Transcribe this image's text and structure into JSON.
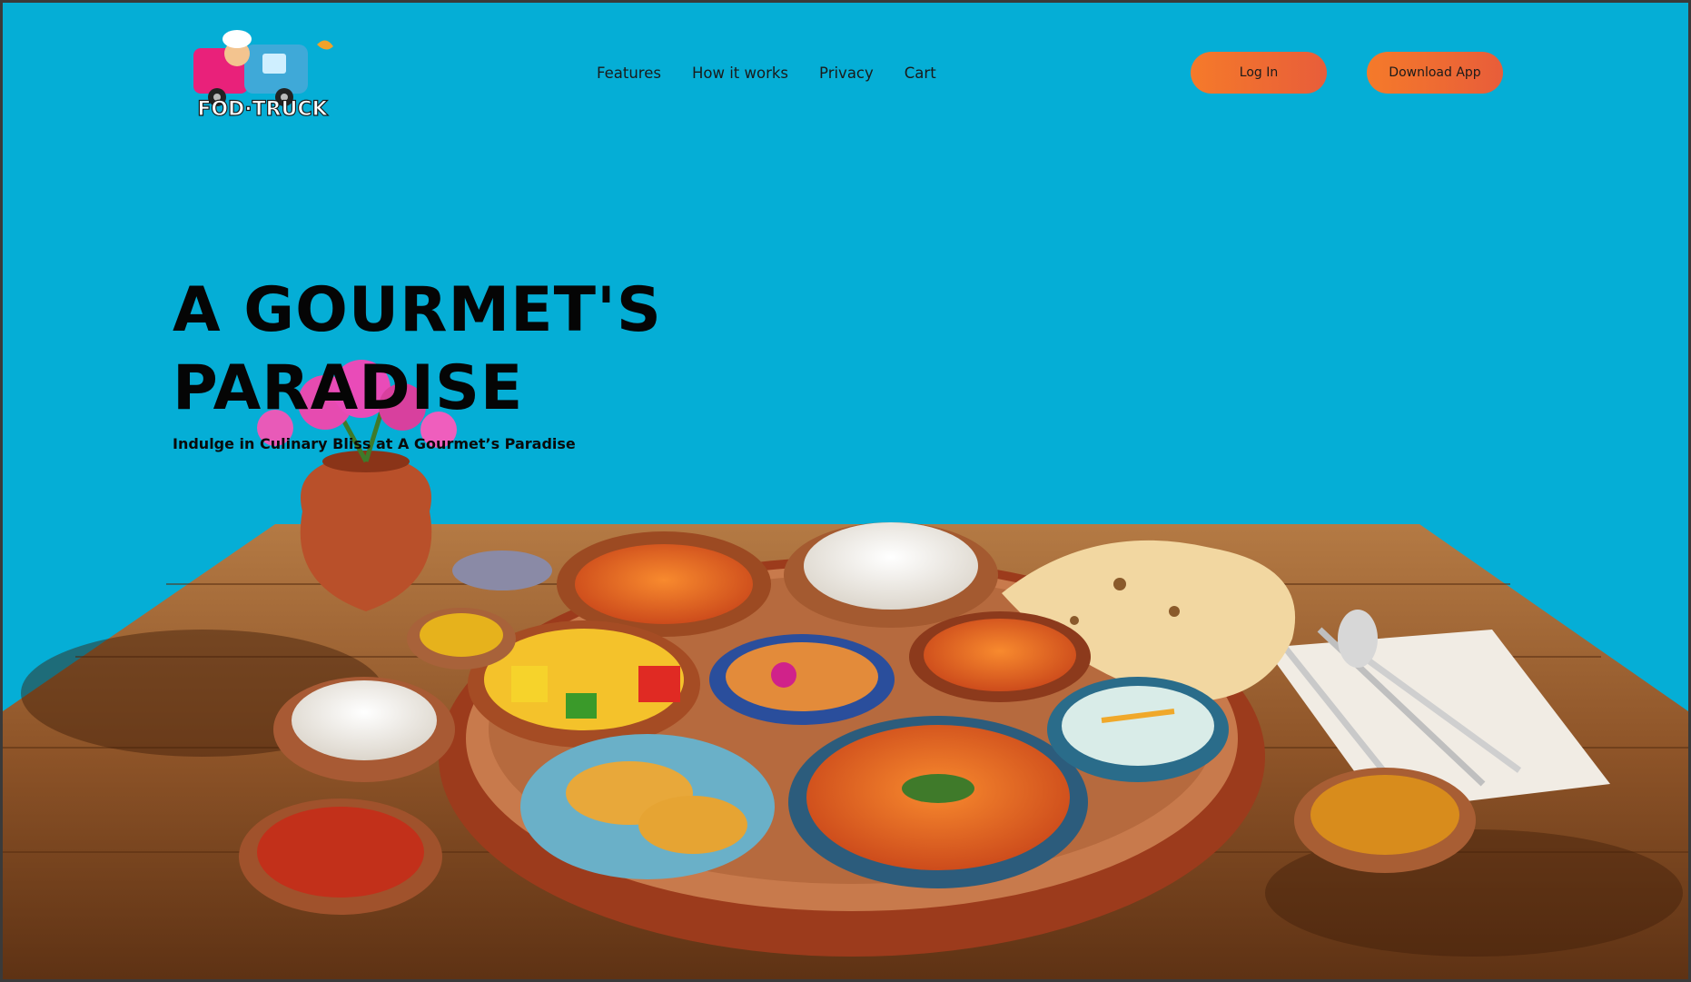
{
  "brand": {
    "logo_text": "FOD·TRUCK",
    "logo_icon": "food-truck-chef-logo"
  },
  "nav": {
    "items": [
      {
        "label": "Features"
      },
      {
        "label": "How it works"
      },
      {
        "label": "Privacy"
      },
      {
        "label": "Cart"
      }
    ]
  },
  "header": {
    "login_label": "Log In",
    "download_label": "Download App"
  },
  "hero": {
    "title_line1": "A GOURMET'S",
    "title_line2": "PARADISE",
    "subtitle": "Indulge in Culinary Bliss at A Gourmet’s Paradise",
    "image": "thali-food-platter-on-wooden-table"
  },
  "colors": {
    "background": "#05aed6",
    "button_start": "#f57a2a",
    "button_end": "#e85d3a",
    "text": "#050505"
  }
}
